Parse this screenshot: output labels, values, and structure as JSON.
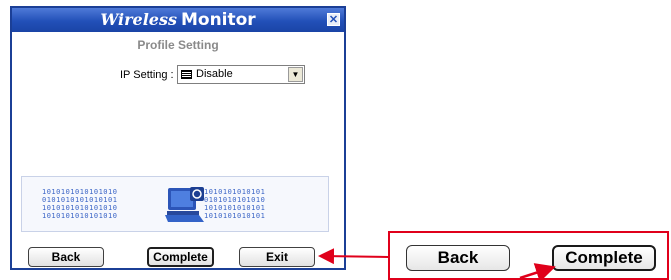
{
  "window": {
    "title_brand": "Wireless",
    "title_app": "Monitor",
    "close_glyph": "✕",
    "subtitle": "Profile Setting"
  },
  "ip_setting": {
    "label": "IP Setting :",
    "selected": "Disable",
    "arrow_glyph": "▼"
  },
  "banner": {
    "binary_left": [
      "1010101010101010",
      "0101010101010101",
      "1010101010101010",
      "1010101010101010"
    ],
    "binary_right": [
      "1010101010101",
      "0101010101010",
      "1010101010101",
      "1010101010101"
    ]
  },
  "buttons": {
    "back": "Back",
    "complete": "Complete",
    "exit": "Exit"
  },
  "callout": {
    "back": "Back",
    "complete": "Complete"
  },
  "colors": {
    "titlebar": "#2250b8",
    "callout_border": "#e0001b",
    "arrow": "#e0001b"
  }
}
